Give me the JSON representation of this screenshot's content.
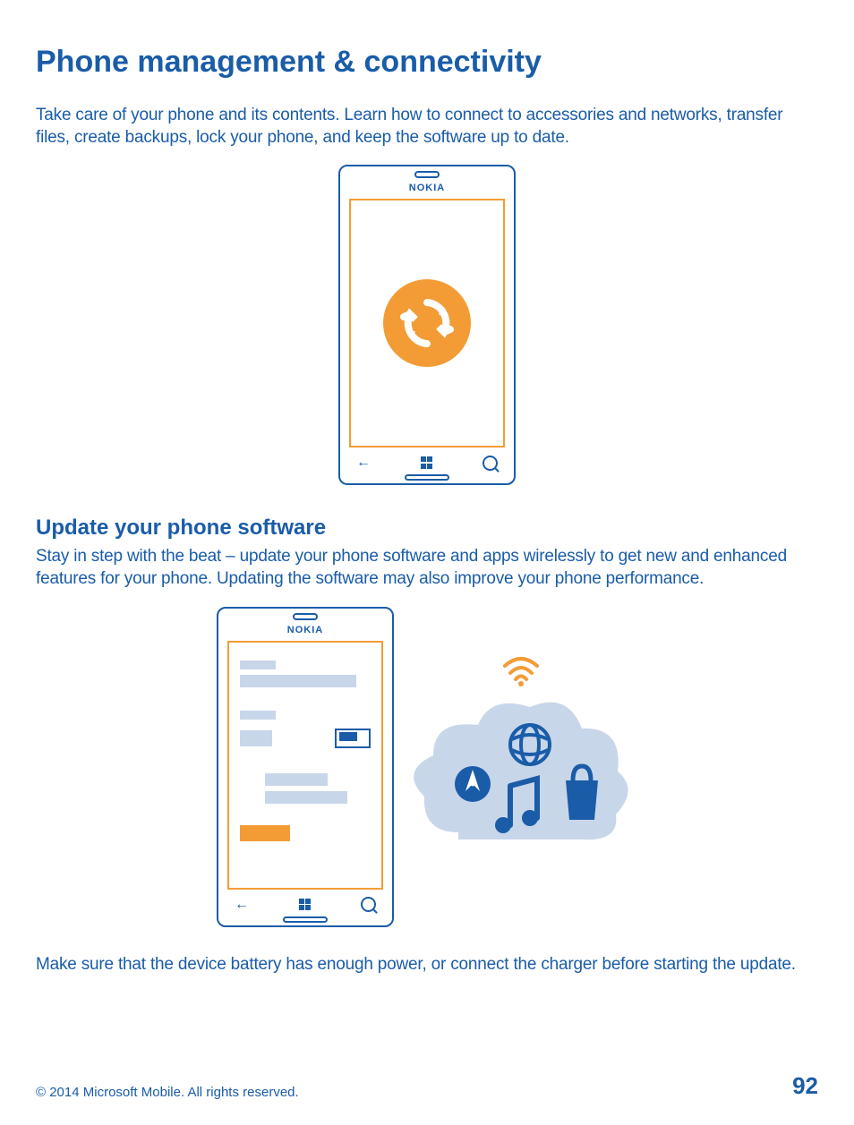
{
  "title": "Phone management & connectivity",
  "intro": "Take care of your phone and its contents. Learn how to connect to accessories and networks, transfer files, create backups, lock your phone, and keep the software up to date.",
  "phone_brand": "NOKIA",
  "section2_title": "Update your phone software",
  "section2_body": "Stay in step with the beat – update your phone software and apps wirelessly to get new and enhanced features for your phone. Updating the software may also improve your phone performance.",
  "note": "Make sure that the device battery has enough power, or connect the charger before starting the update.",
  "copyright": "© 2014 Microsoft Mobile. All rights reserved.",
  "page_number": "92"
}
